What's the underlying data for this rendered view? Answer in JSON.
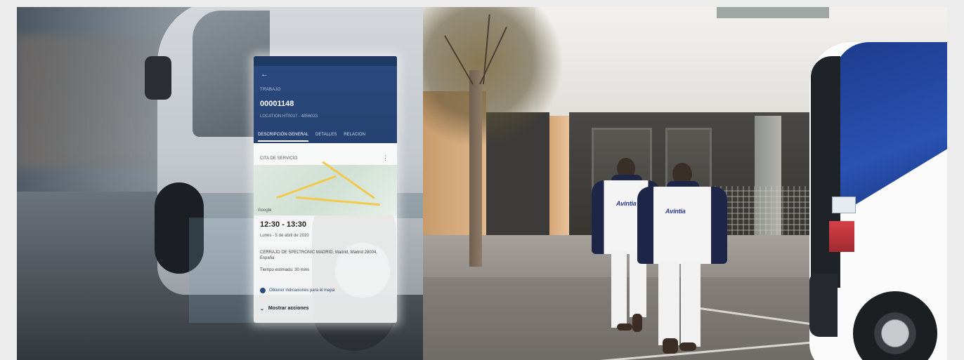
{
  "left_photo": {
    "phone_screen": {
      "title_label": "TRABAJO",
      "job_number": "00001148",
      "subtitle": "LOCATION HT0017 - 4856023",
      "tabs": [
        "DESCRIPCIÓN GENERAL",
        "DETALLES",
        "RELACION"
      ],
      "section_label": "CITA DE SERVICIO",
      "map_watermark": "Google",
      "time_range": "12:30 - 13:30",
      "date": "Lunes - 5 de abril de 2020",
      "address": "CERRAJO DE SPELTRONIC MADRID, Madrid, Madrid 28004, España",
      "duration": "Tiempo estimado: 30 mins",
      "directions_link": "Obtener indicaciones para el mapa",
      "more_actions": "Mostrar acciones"
    }
  },
  "right_photo": {
    "uniform_logo": "Avintia",
    "worker_count": 2
  }
}
